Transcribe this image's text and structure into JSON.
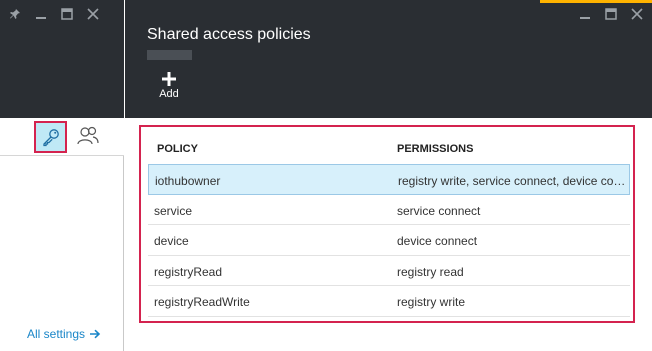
{
  "left_blade": {
    "window_controls": [
      "pin-icon",
      "minimize-icon",
      "maximize-icon",
      "close-icon"
    ],
    "toolbar": {
      "key_icon": "key-icon",
      "users_icon": "users-icon"
    },
    "all_settings": {
      "label": "All settings",
      "icon": "arrow-right-icon"
    }
  },
  "right_blade": {
    "title": "Shared access policies",
    "window_controls": [
      "minimize-icon",
      "maximize-icon",
      "close-icon"
    ],
    "add": {
      "label": "Add",
      "icon": "plus-icon"
    }
  },
  "policy_table": {
    "headers": {
      "policy": "POLICY",
      "permissions": "PERMISSIONS"
    },
    "rows": [
      {
        "policy": "iothubowner",
        "permissions": "registry write, service connect, device connect",
        "selected": true
      },
      {
        "policy": "service",
        "permissions": "service connect",
        "selected": false
      },
      {
        "policy": "device",
        "permissions": "device connect",
        "selected": false
      },
      {
        "policy": "registryRead",
        "permissions": "registry read",
        "selected": false
      },
      {
        "policy": "registryReadWrite",
        "permissions": "registry write",
        "selected": false
      }
    ]
  },
  "colors": {
    "header_bg": "#2a2e33",
    "highlight_border": "#d4234f",
    "accent": "#ffb300",
    "link": "#1a86c8",
    "selected_row": "#d7f0fb"
  }
}
